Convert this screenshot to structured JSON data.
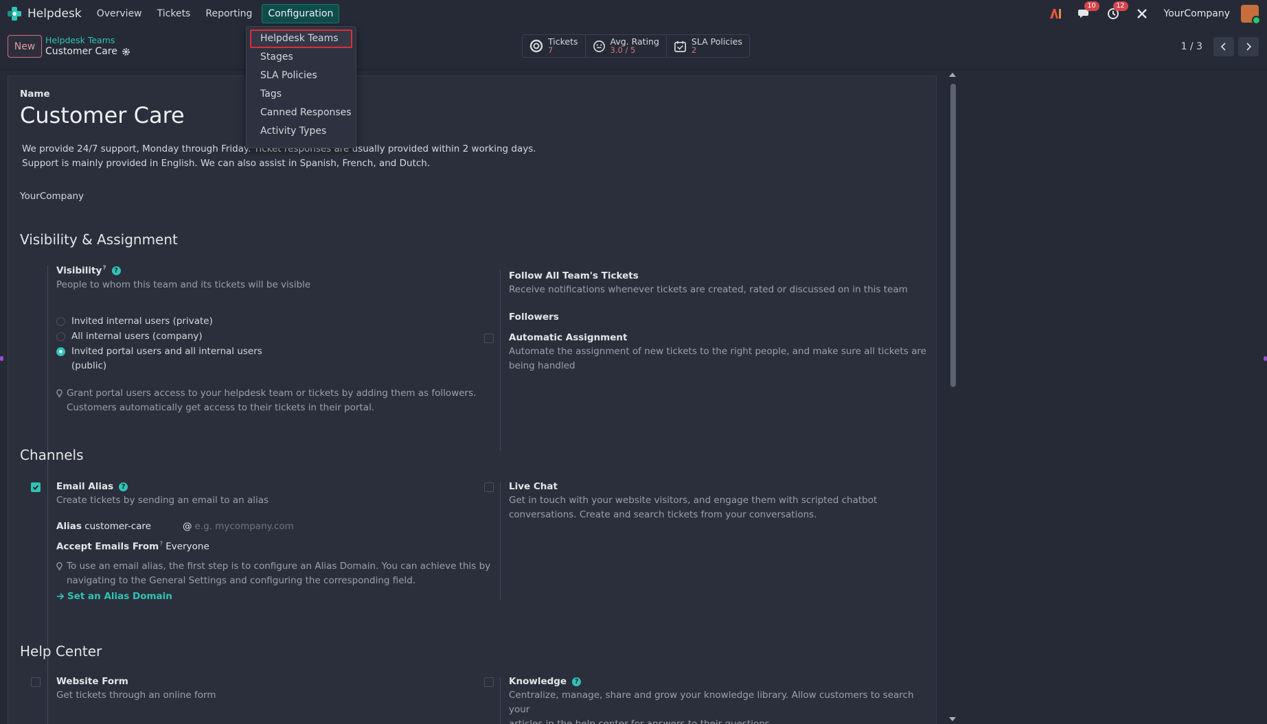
{
  "topbar": {
    "app_name": "Helpdesk",
    "nav": [
      "Overview",
      "Tickets",
      "Reporting",
      "Configuration"
    ],
    "messages_badge": "10",
    "activities_badge": "12",
    "company": "YourCompany"
  },
  "config_menu": {
    "items": [
      "Helpdesk Teams",
      "Stages",
      "SLA Policies",
      "Tags",
      "Canned Responses",
      "Activity Types"
    ]
  },
  "control": {
    "new_label": "New",
    "breadcrumb_parent": "Helpdesk Teams",
    "breadcrumb_current": "Customer Care",
    "stats": [
      {
        "label": "Tickets",
        "value": "7"
      },
      {
        "label": "Avg. Rating",
        "value": "3.0 / 5"
      },
      {
        "label": "SLA Policies",
        "value": "2"
      }
    ],
    "pager": "1 / 3"
  },
  "form": {
    "name_label": "Name",
    "name": "Customer Care",
    "description_line1": "We provide 24/7 support, Monday through Friday. Ticket responses are usually provided within 2 working days.",
    "description_line2": "Support is mainly provided in English. We can also assist in Spanish, French, and Dutch.",
    "company": "YourCompany",
    "visibility_section": "Visibility & Assignment",
    "visibility_label": "Visibility",
    "visibility_sup": "?",
    "visibility_help": "People to whom this team and its tickets will be visible",
    "visibility_options": [
      "Invited internal users (private)",
      "All internal users (company)",
      "Invited portal users and all internal users",
      "(public)"
    ],
    "visibility_tip_line1": "Grant portal users access to your helpdesk team or tickets by adding them as followers.",
    "visibility_tip_line2": "Customers automatically get access to their tickets in their portal.",
    "follow_label": "Follow All Team's Tickets",
    "follow_help": "Receive notifications whenever tickets are created, rated or discussed on in this team",
    "followers_label": "Followers",
    "auto_assign_label": "Automatic Assignment",
    "auto_assign_help_line1": "Automate the assignment of new tickets to the right people, and make sure all tickets are",
    "auto_assign_help_line2": "being handled",
    "channels_section": "Channels",
    "email_alias_label": "Email Alias",
    "email_alias_help": "Create tickets by sending an email to an alias",
    "alias_label": "Alias",
    "alias_value": "customer-care",
    "alias_at": "@",
    "alias_domain_placeholder": "e.g. mycompany.com",
    "accept_label": "Accept Emails From",
    "accept_sup": "?",
    "accept_value": "Everyone",
    "alias_tip_line1": "To use an email alias, the first step is to configure an Alias Domain. You can achieve this by",
    "alias_tip_line2": "navigating to the General Settings and configuring the corresponding field.",
    "alias_link": "Set an Alias Domain",
    "live_chat_label": "Live Chat",
    "live_chat_help_line1": "Get in touch with your website visitors, and engage them with scripted chatbot",
    "live_chat_help_line2": "conversations. Create and search tickets from your conversations.",
    "help_center_section": "Help Center",
    "website_form_label": "Website Form",
    "website_form_help": "Get tickets through an online form",
    "knowledge_label": "Knowledge",
    "knowledge_help_line1": "Centralize, manage, share and grow your knowledge library. Allow customers to search your",
    "knowledge_help_line2": "articles in the help center for answers to their questions."
  },
  "colors": {
    "accent": "#2ec4b6",
    "background": "#262a36",
    "sheet": "#2b2f3b",
    "highlight_outline": "#e02d35"
  }
}
